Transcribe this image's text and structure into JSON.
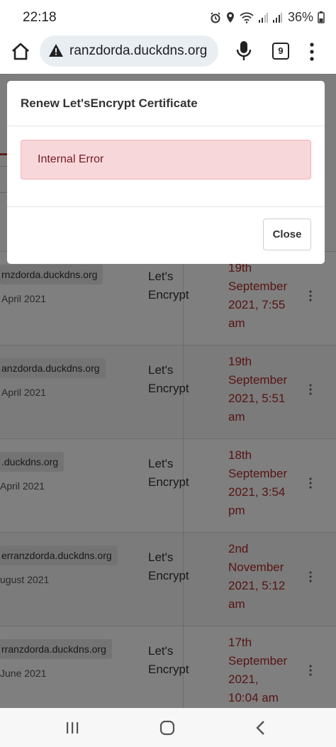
{
  "status_bar": {
    "time": "22:18",
    "battery": "36%",
    "icons": [
      "alarm-icon",
      "location-icon",
      "wifi-icon",
      "signal-icon",
      "signal-icon-2",
      "battery-icon"
    ]
  },
  "browser": {
    "url": "ranzdorda.duckdns.org",
    "tab_count": "9",
    "icons": [
      "home-icon",
      "warning-icon",
      "mic-icon",
      "tabs-icon",
      "menu-dots-icon"
    ]
  },
  "modal": {
    "title": "Renew Let'sEncrypt Certificate",
    "error_message": "Internal Error",
    "close_label": "Close"
  },
  "certificates": [
    {
      "domain": "rnzdorda.duckdns.org",
      "created": "April 2021",
      "provider_line1": "Let's",
      "provider_line2": "Encrypt",
      "expiry_lines": [
        "19th",
        "September",
        "2021, 7:55",
        "am"
      ]
    },
    {
      "domain": "anzdorda.duckdns.org",
      "created": "April 2021",
      "provider_line1": "Let's",
      "provider_line2": "Encrypt",
      "expiry_lines": [
        "19th",
        "September",
        "2021, 5:51",
        "am"
      ]
    },
    {
      "domain": ".duckdns.org",
      "created": "April 2021",
      "provider_line1": "Let's",
      "provider_line2": "Encrypt",
      "expiry_lines": [
        "18th",
        "September",
        "2021, 3:54",
        "pm"
      ]
    },
    {
      "domain": "erranzdorda.duckdns.org",
      "created": "ugust 2021",
      "provider_line1": "Let's",
      "provider_line2": "Encrypt",
      "expiry_lines": [
        "2nd",
        "November",
        "2021, 5:12",
        "am"
      ]
    },
    {
      "domain": "rranzdorda.duckdns.org",
      "created": "June 2021",
      "provider_line1": "Let's",
      "provider_line2": "Encrypt",
      "expiry_lines": [
        "17th",
        "September",
        "2021,",
        "10:04 am"
      ]
    }
  ],
  "colors": {
    "expiry_text": "#b02a2a",
    "alert_bg": "#f8d7da",
    "alert_text": "#721c24",
    "overlay": "rgba(0,0,0,0.5)"
  },
  "nav_bar": {
    "icons": [
      "recent-apps-icon",
      "home-circle-icon",
      "back-icon"
    ]
  }
}
